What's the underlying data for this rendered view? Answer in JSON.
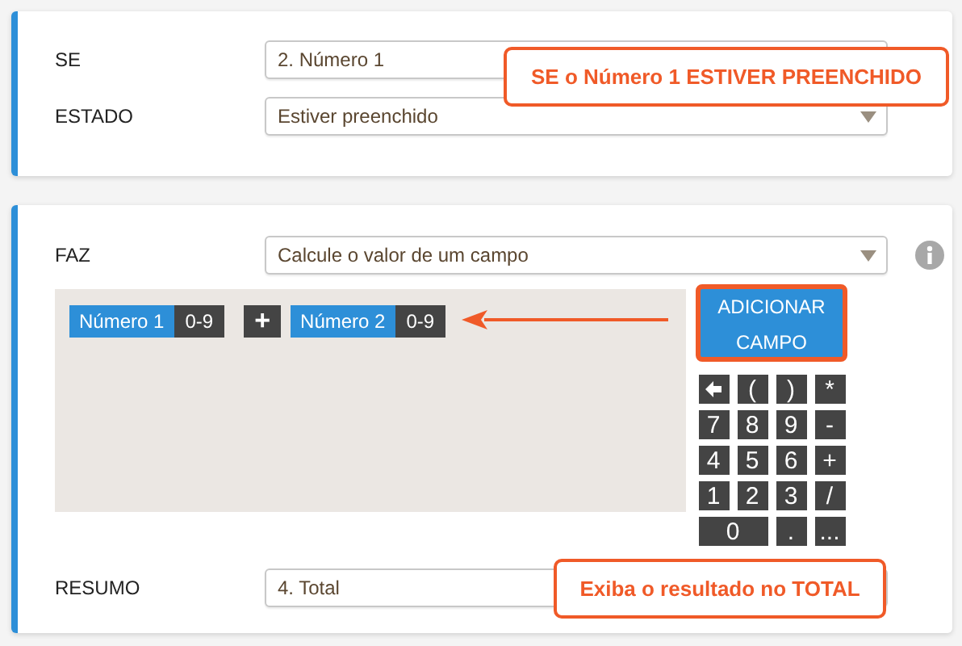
{
  "condition": {
    "rows": [
      {
        "label": "SE",
        "value": "2. Número 1"
      },
      {
        "label": "ESTADO",
        "value": "Estiver preenchido"
      }
    ],
    "callout": "SE o Número 1 ESTIVER PREENCHIDO"
  },
  "action": {
    "label": "FAZ",
    "value": "Calcule o valor de um campo",
    "formula": [
      {
        "kind": "field",
        "name": "Número 1",
        "type": "0-9"
      },
      {
        "kind": "operator",
        "symbol": "+"
      },
      {
        "kind": "field",
        "name": "Número 2",
        "type": "0-9"
      }
    ],
    "add_button": "ADICIONAR CAMPO",
    "keypad": [
      {
        "kind": "backspace"
      },
      {
        "kind": "key",
        "label": "("
      },
      {
        "kind": "key",
        "label": ")"
      },
      {
        "kind": "key",
        "label": "*"
      },
      {
        "kind": "key",
        "label": "7"
      },
      {
        "kind": "key",
        "label": "8"
      },
      {
        "kind": "key",
        "label": "9"
      },
      {
        "kind": "key",
        "label": "-"
      },
      {
        "kind": "key",
        "label": "4"
      },
      {
        "kind": "key",
        "label": "5"
      },
      {
        "kind": "key",
        "label": "6"
      },
      {
        "kind": "key",
        "label": "+"
      },
      {
        "kind": "key",
        "label": "1"
      },
      {
        "kind": "key",
        "label": "2"
      },
      {
        "kind": "key",
        "label": "3"
      },
      {
        "kind": "key",
        "label": "/"
      },
      {
        "kind": "wide",
        "label": "0"
      },
      {
        "kind": "key",
        "label": "."
      },
      {
        "kind": "key",
        "label": "..."
      }
    ],
    "summary": {
      "label": "RESUMO",
      "value": "4. Total"
    },
    "callout": "Exiba o resultado no TOTAL"
  }
}
